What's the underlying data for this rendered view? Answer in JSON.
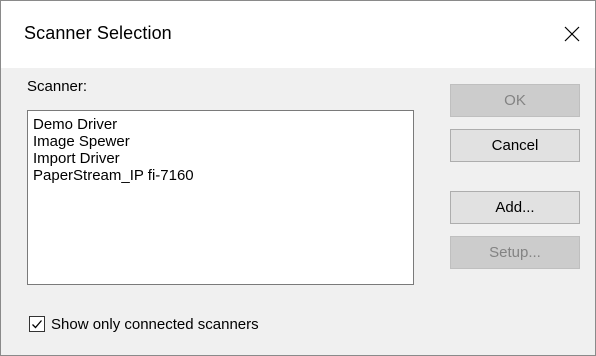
{
  "window": {
    "title": "Scanner Selection",
    "close_icon": "close-icon"
  },
  "scanner": {
    "label": "Scanner:",
    "items": [
      "Demo Driver",
      "Image Spewer",
      "Import Driver",
      "PaperStream_IP fi-7160"
    ]
  },
  "buttons": {
    "ok": {
      "label": "OK",
      "enabled": false
    },
    "cancel": {
      "label": "Cancel",
      "enabled": true
    },
    "add": {
      "label": "Add...",
      "enabled": true
    },
    "setup": {
      "label": "Setup...",
      "enabled": false
    }
  },
  "filter": {
    "label": "Show only connected scanners",
    "checked": true,
    "check_icon": "checkmark-icon"
  }
}
